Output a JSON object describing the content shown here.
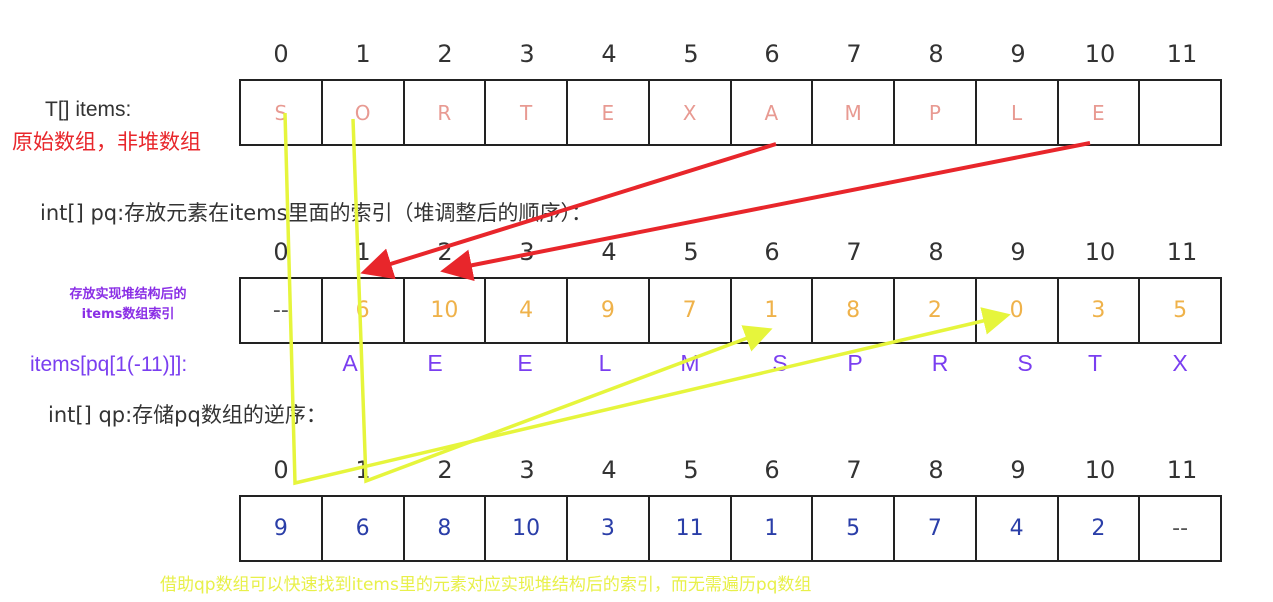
{
  "labels": {
    "items_array": "T[] items:",
    "items_note": "原始数组，非堆数组",
    "pq_caption": "int[] pq:存放元素在items里面的索引（堆调整后的顺序）：",
    "pq_note_line1": "存放实现堆结构后的",
    "pq_note_line2": "items数组索引",
    "mapped_label": "items[pq[1(-11)]]:",
    "qp_caption": "int[] qp:存储pq数组的逆序：",
    "footer_note": "借助qp数组可以快速找到items里的元素对应实现堆结构后的索引，而无需遍历pq数组"
  },
  "indices": [
    "0",
    "1",
    "2",
    "3",
    "4",
    "5",
    "6",
    "7",
    "8",
    "9",
    "10",
    "11"
  ],
  "items": [
    "S",
    "O",
    "R",
    "T",
    "E",
    "X",
    "A",
    "M",
    "P",
    "L",
    "E",
    ""
  ],
  "pq": [
    "--",
    "6",
    "10",
    "4",
    "9",
    "7",
    "1",
    "8",
    "2",
    "0",
    "3",
    "5"
  ],
  "mapped": [
    "A",
    "E",
    "E",
    "L",
    "M",
    "S",
    "P",
    "R",
    "S",
    "T",
    "X"
  ],
  "qp": [
    "9",
    "6",
    "8",
    "10",
    "3",
    "11",
    "1",
    "5",
    "7",
    "4",
    "2",
    "--"
  ],
  "colors": {
    "items_text": "#e89a92",
    "pq_text": "#efb24a",
    "qp_text": "#2a3ea8",
    "mapped_text": "#7a3ef0",
    "red_arrow": "#e8262b",
    "green_arrow": "#e6f53c",
    "footer_text": "#e8f04a",
    "note_red": "#e8262b",
    "note_purple": "#8a2ee6"
  }
}
